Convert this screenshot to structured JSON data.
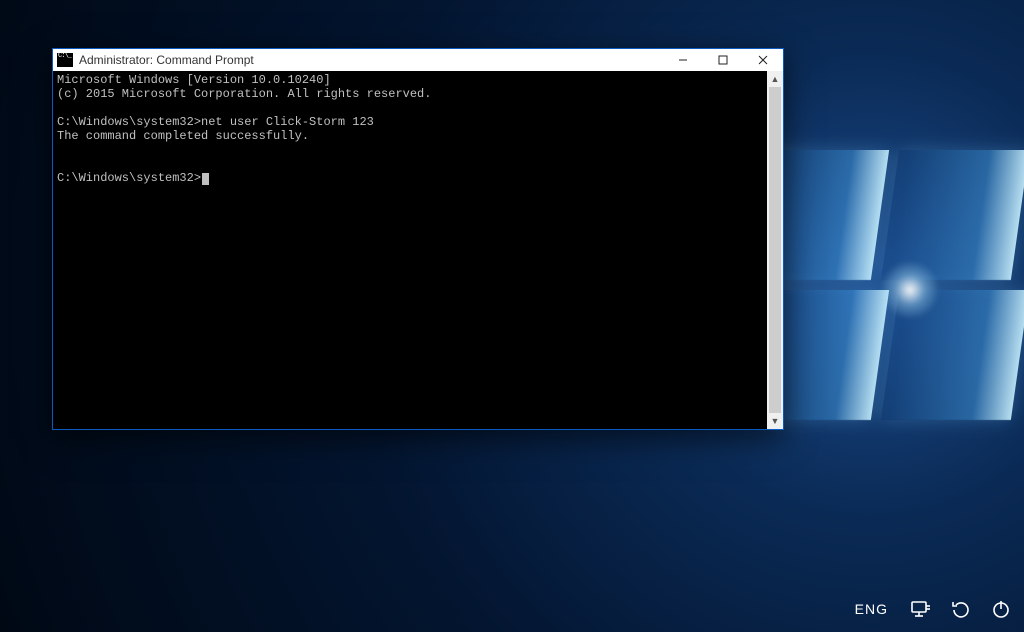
{
  "window": {
    "title": "Administrator: Command Prompt"
  },
  "terminal": {
    "line1": "Microsoft Windows [Version 10.0.10240]",
    "line2": "(c) 2015 Microsoft Corporation. All rights reserved.",
    "blank1": "",
    "prompt1_path": "C:\\Windows\\system32>",
    "prompt1_cmd": "net user Click-Storm 123",
    "result1": "The command completed successfully.",
    "blank2": "",
    "blank3": "",
    "prompt2_path": "C:\\Windows\\system32>"
  },
  "tray": {
    "language": "ENG"
  }
}
